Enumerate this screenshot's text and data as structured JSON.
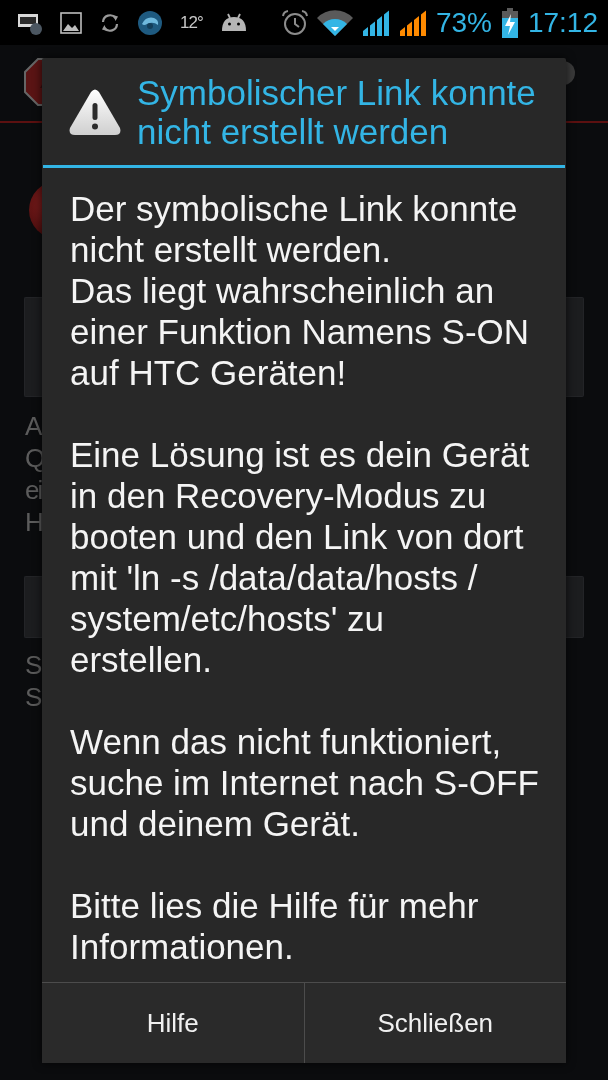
{
  "status_bar": {
    "temperature": "12°",
    "battery_percent": "73%",
    "time": "17:12"
  },
  "background": {
    "paragraphs": [
      [
        "A",
        "Q",
        "ei",
        "H"
      ],
      [
        "S",
        "S"
      ]
    ]
  },
  "dialog": {
    "title": "Symbolischer Link konnte nicht erstellt werden",
    "message": [
      [
        "Der symbolische Link konnte",
        "nicht erstellt werden.",
        "Das liegt wahrscheinlich an",
        "einer Funktion Namens S-ON",
        "auf HTC Geräten!"
      ],
      [
        "Eine Lösung ist es dein Gerät",
        "in den Recovery-Modus zu",
        "booten und den Link von dort",
        "mit 'ln -s /data/data/hosts /",
        "system/etc/hosts' zu",
        "erstellen."
      ],
      [
        "Wenn das nicht funktioniert,",
        "suche im Internet nach S-OFF",
        "und deinem Gerät."
      ],
      [
        "Bitte lies die Hilfe für mehr",
        "Informationen."
      ]
    ],
    "buttons": [
      {
        "label": "Hilfe"
      },
      {
        "label": "Schließen"
      }
    ]
  }
}
